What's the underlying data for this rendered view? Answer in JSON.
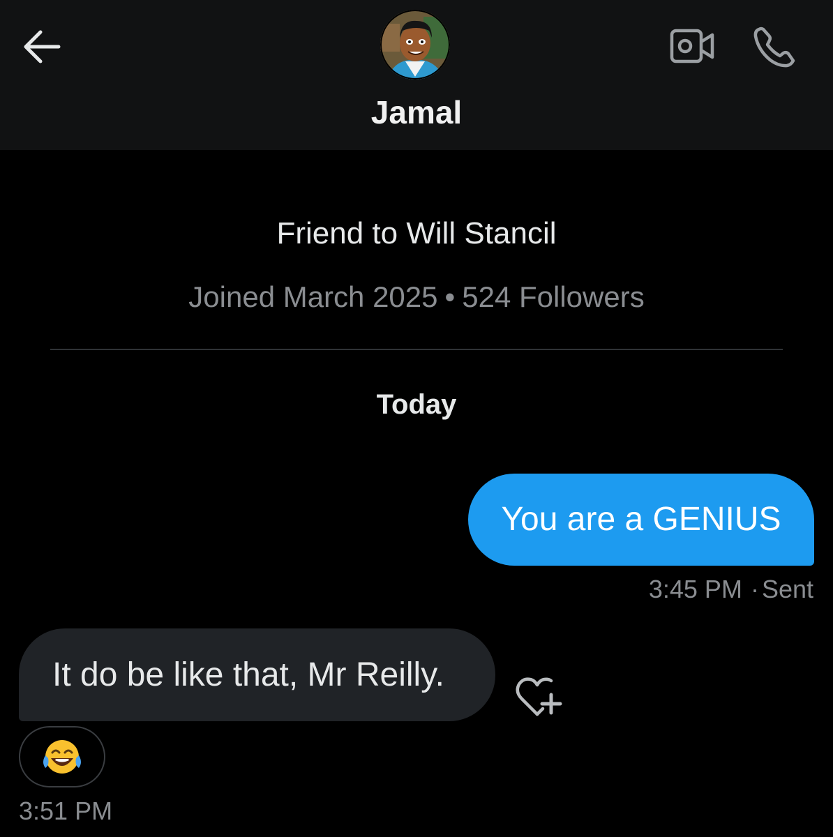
{
  "header": {
    "contact_name": "Jamal",
    "icons": [
      "arrow-left-icon",
      "video-camera-icon",
      "phone-icon"
    ]
  },
  "profile": {
    "bio": "Friend to Will Stancil",
    "joined": "Joined March 2025",
    "separator": "•",
    "followers": "524 Followers"
  },
  "thread": {
    "day_label": "Today",
    "messages": [
      {
        "direction": "sent",
        "text": "You are a GENIUS",
        "time": "3:45 PM",
        "status": "Sent",
        "status_separator": "·"
      },
      {
        "direction": "received",
        "text": "It do be like that, Mr Reilly.",
        "time": "3:51 PM",
        "reaction": "face-with-tears-of-joy"
      }
    ]
  },
  "colors": {
    "background": "#000000",
    "header_bg": "#111213",
    "sent_bubble": "#1d9bf0",
    "received_bubble": "#202327",
    "muted_text": "#8a8d91"
  }
}
